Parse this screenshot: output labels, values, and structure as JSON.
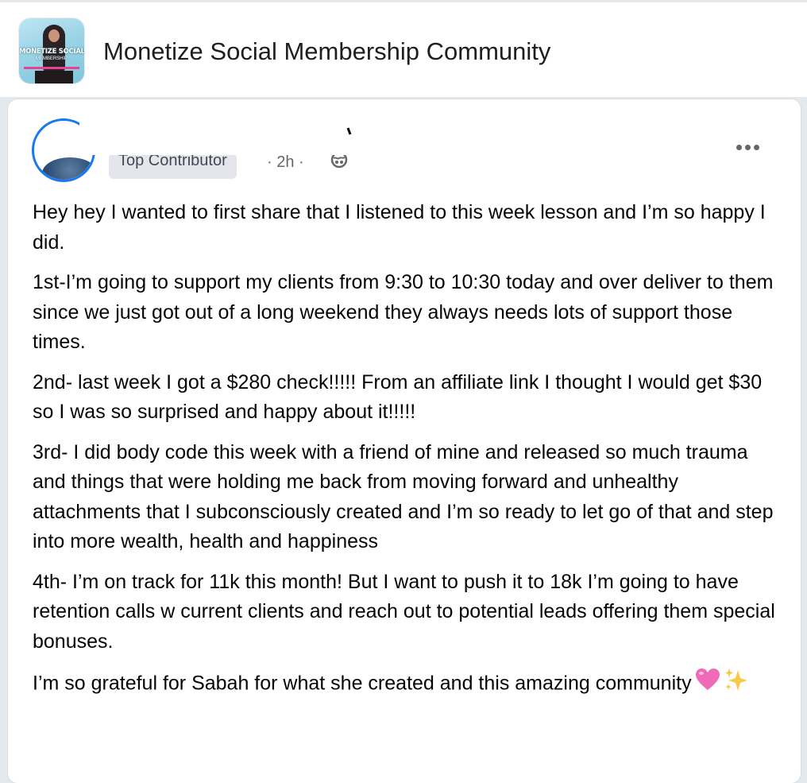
{
  "group": {
    "name": "Monetize Social Membership Community",
    "thumbnail_title": "MONETIZE SOCIAL",
    "thumbnail_subtitle": "MEMBERSHIP"
  },
  "post": {
    "author_badge": "Top Contributor",
    "timestamp": "· 2h ·",
    "privacy_icon": "globe-icon",
    "more_options_icon": "more-options-icon",
    "paragraphs": [
      "Hey hey I wanted to first share that I listened to this week lesson and I’m so happy I did.",
      "1st-I’m going to support my clients from 9:30 to 10:30 today and over deliver to them since we just got out of a long weekend they always needs lots of support those times.",
      "2nd- last week I got a $280 check!!!!! From an affiliate link I thought I would get $30 so I was so surprised and happy about it!!!!!",
      "3rd- I did body code this week with a friend of mine and released so much trauma and things that were holding me back from moving forward and unhealthy attachments that I subconsciously created and I’m so ready to let go of that and step into more wealth, health and happiness",
      "4th- I’m on track for 11k this month! But I want to push it to 18k I’m going to have retention calls w current clients and reach out to potential leads offering them special bonuses.",
      "I’m so grateful for Sabah for what she created and this amazing community"
    ],
    "closing_emojis": [
      "pink-heart-icon",
      "sparkles-icon"
    ]
  },
  "colors": {
    "accent": "#1877f2",
    "badge_bg": "#e4e6eb",
    "secondary_text": "#65676b",
    "page_bg": "#e4e9ee",
    "heart": "#f06bb7",
    "sparkles": "#f7c948"
  }
}
